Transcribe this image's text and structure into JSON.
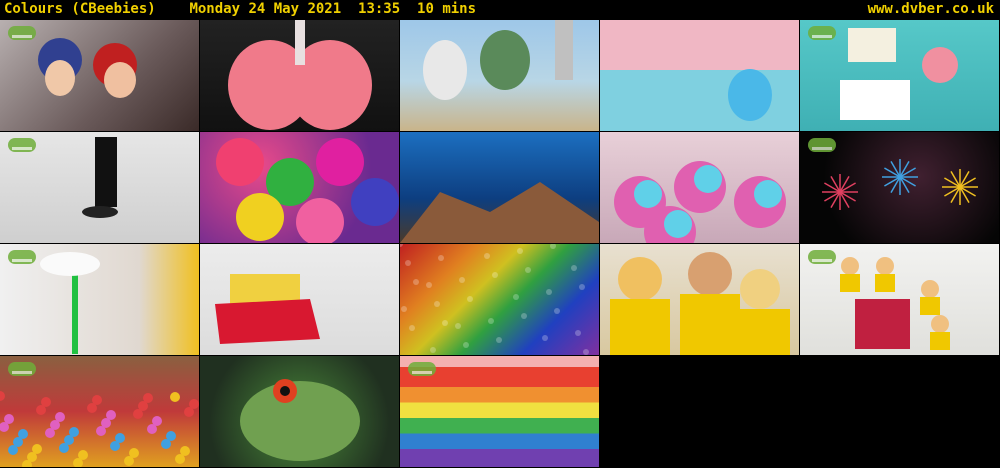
{
  "header": {
    "channel": "Colours (CBeebies)",
    "date": "Monday 24 May 2021",
    "time": "13:35",
    "duration": "10 mins",
    "site": "www.dvber.co.uk"
  },
  "colors": {
    "header_text": "#f0d000",
    "background": "#000000"
  },
  "thumbnails": [
    {
      "name": "thumb-cartoon-boys-car",
      "bg": "linear-gradient(135deg,#b8b0b0,#6a5a5a 60%,#3a2a28)"
    },
    {
      "name": "thumb-lungs",
      "bg": "linear-gradient(180deg,#222 0%,#111 100%)"
    },
    {
      "name": "thumb-cartoon-robots",
      "bg": "linear-gradient(180deg,#9ec7e8 0%,#b8d6e6 55%,#c9b48a 100%)"
    },
    {
      "name": "thumb-credits-blue-creature",
      "bg": "linear-gradient(180deg,#f0b7c4 0%,#f0b7c4 45%,#7fd0e0 45%,#7fd0e0 100%)"
    },
    {
      "name": "thumb-story-time-menu",
      "bg": "linear-gradient(180deg,#56c8c8,#3fb0b4)"
    },
    {
      "name": "thumb-feet-walking",
      "bg": "linear-gradient(180deg,#e6e6e6,#cfcfcf)"
    },
    {
      "name": "thumb-gumballs",
      "bg": "radial-gradient(circle at 30% 30%,#e84a8a,#6a2a90 70%)"
    },
    {
      "name": "thumb-coral-reef",
      "bg": "linear-gradient(180deg,#1c6fc0,#0d3e80 60%,#4a3a2a)"
    },
    {
      "name": "thumb-rainbow-cupcakes",
      "bg": "linear-gradient(180deg,#e8d0d8,#c8a8b8)"
    },
    {
      "name": "thumb-fireworks",
      "bg": "radial-gradient(circle at 60% 40%,#402030,#050505 70%)"
    },
    {
      "name": "thumb-green-liquid-pour",
      "bg": "linear-gradient(90deg,#f0f0f0,#e0d8d0 70%,#f0c020)"
    },
    {
      "name": "thumb-sponge-red-paint",
      "bg": "linear-gradient(180deg,#ececec,#dcdcdc)"
    },
    {
      "name": "thumb-rainbow-powder",
      "bg": "linear-gradient(135deg,#c02020,#e08020 25%,#d0c020 40%,#30a040 55%,#2040c0 75%,#8030a0)"
    },
    {
      "name": "thumb-children-painting",
      "bg": "linear-gradient(180deg,#e8e0d0,#d8c8a0)"
    },
    {
      "name": "thumb-children-floor-art",
      "bg": "linear-gradient(180deg,#f2f2f0,#e0e0dc)"
    },
    {
      "name": "thumb-holi-crowd",
      "bg": "linear-gradient(180deg,#8a6040,#c03a3a 50%,#e0a020)"
    },
    {
      "name": "thumb-chameleon",
      "bg": "radial-gradient(circle at 50% 60%,#4a8a3a,#203020 75%)"
    },
    {
      "name": "thumb-rainbow-stripes",
      "bg": "linear-gradient(180deg,#f4b0b0 0%,#f4b0b0 10%,#e84030 10%,#e84030 28%,#f09030 28%,#f09030 42%,#f0e040 42%,#f0e040 56%,#40b050 56%,#40b050 70%,#3080d0 70%,#3080d0 84%,#7040b0 84%,#7040b0 100%)"
    }
  ]
}
